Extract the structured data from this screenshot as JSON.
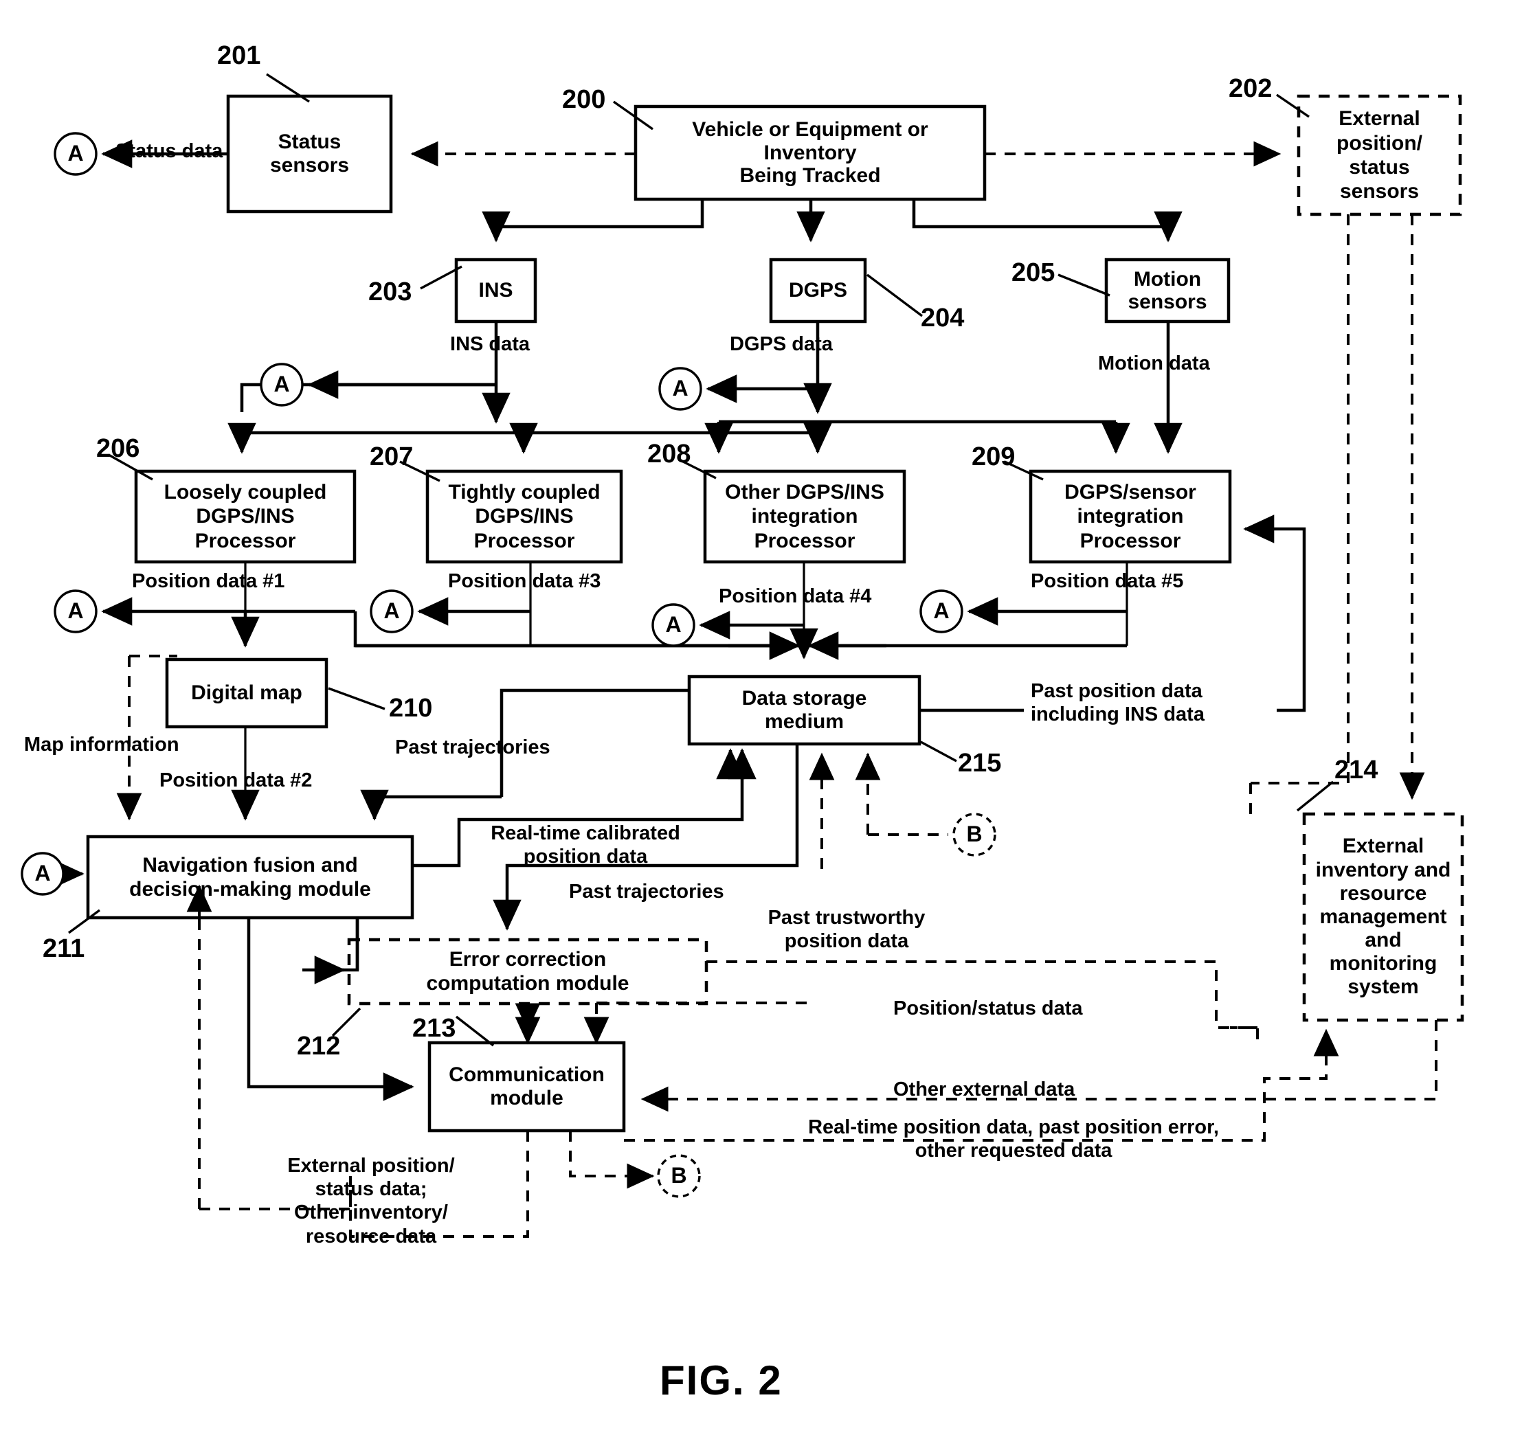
{
  "figure": {
    "caption": "FIG. 2",
    "type": "patent-block-diagram"
  },
  "blocks": [
    {
      "id": "200",
      "label": "Vehicle or Equipment or\nInventory\nBeing Tracked",
      "lines": [
        "Vehicle or Equipment or",
        "Inventory",
        "Being Tracked"
      ],
      "style": "solid"
    },
    {
      "id": "201",
      "label": "Status sensors",
      "lines": [
        "Status",
        "sensors"
      ],
      "style": "solid"
    },
    {
      "id": "202",
      "label": "External position/ status sensors",
      "lines": [
        "External",
        "position/",
        "status",
        "sensors"
      ],
      "style": "dashed"
    },
    {
      "id": "203",
      "label": "INS",
      "lines": [
        "INS"
      ],
      "style": "solid"
    },
    {
      "id": "204",
      "label": "DGPS",
      "lines": [
        "DGPS"
      ],
      "style": "solid"
    },
    {
      "id": "205",
      "label": "Motion sensors",
      "lines": [
        "Motion",
        "sensors"
      ],
      "style": "solid"
    },
    {
      "id": "206",
      "label": "Loosely coupled DGPS/INS Processor",
      "lines": [
        "Loosely coupled",
        "DGPS/INS",
        "Processor"
      ],
      "style": "solid"
    },
    {
      "id": "207",
      "label": "Tightly coupled DGPS/INS Processor",
      "lines": [
        "Tightly coupled",
        "DGPS/INS",
        "Processor"
      ],
      "style": "solid"
    },
    {
      "id": "208",
      "label": "Other DGPS/INS integration Processor",
      "lines": [
        "Other DGPS/INS",
        "integration",
        "Processor"
      ],
      "style": "solid"
    },
    {
      "id": "209",
      "label": "DGPS/sensor integration Processor",
      "lines": [
        "DGPS/sensor",
        "integration",
        "Processor"
      ],
      "style": "solid"
    },
    {
      "id": "210",
      "label": "Digital map",
      "lines": [
        "Digital map"
      ],
      "style": "solid"
    },
    {
      "id": "211",
      "label": "Navigation fusion and decision-making module",
      "lines": [
        "Navigation fusion and",
        "decision-making module"
      ],
      "style": "solid"
    },
    {
      "id": "212",
      "label": "Error correction computation module",
      "lines": [
        "Error correction",
        "computation module"
      ],
      "style": "dashed"
    },
    {
      "id": "213",
      "label": "Communication module",
      "lines": [
        "Communication",
        "module"
      ],
      "style": "solid"
    },
    {
      "id": "214",
      "label": "External inventory and resource management and monitoring system",
      "lines": [
        "External",
        "inventory and",
        "resource",
        "management",
        "and",
        "monitoring",
        "system"
      ],
      "style": "dashed"
    },
    {
      "id": "215",
      "label": "Data storage medium",
      "lines": [
        "Data storage",
        "medium"
      ],
      "style": "solid"
    }
  ],
  "connectors": [
    {
      "id": "A1",
      "symbol": "A",
      "style": "solid"
    },
    {
      "id": "A2",
      "symbol": "A",
      "style": "solid"
    },
    {
      "id": "A3",
      "symbol": "A",
      "style": "solid"
    },
    {
      "id": "A4",
      "symbol": "A",
      "style": "solid"
    },
    {
      "id": "A5",
      "symbol": "A",
      "style": "solid"
    },
    {
      "id": "A6",
      "symbol": "A",
      "style": "solid"
    },
    {
      "id": "A7",
      "symbol": "A",
      "style": "solid"
    },
    {
      "id": "B1",
      "symbol": "B",
      "style": "dashed"
    },
    {
      "id": "B2",
      "symbol": "B",
      "style": "dashed"
    }
  ],
  "edge_labels": {
    "status_data": "Status data",
    "ins_data": "INS data",
    "dgps_data": "DGPS data",
    "motion_data": "Motion data",
    "position_data_1": "Position data #1",
    "position_data_2": "Position data #2",
    "position_data_3": "Position data #3",
    "position_data_4": "Position data #4",
    "position_data_5": "Position data #5",
    "map_information": "Map information",
    "past_trajectories_a": "Past trajectories",
    "past_trajectories_b": "Past trajectories",
    "realtime_calibrated_l1": "Real-time calibrated",
    "realtime_calibrated_l2": "position data",
    "past_trustworthy_l1": "Past trustworthy",
    "past_trustworthy_l2": "position data",
    "past_position_l1": "Past position data",
    "past_position_l2": "including INS data",
    "position_status_data": "Position/status data",
    "other_external_data": "Other external data",
    "realtime_request_l1": "Real-time position data, past position error,",
    "realtime_request_l2": "other requested data",
    "external_status_l1": "External position/",
    "external_status_l2": "status data;",
    "external_status_l3": "Other inventory/",
    "external_status_l4": "resource data"
  },
  "ref_numbers": [
    "200",
    "201",
    "202",
    "203",
    "204",
    "205",
    "206",
    "207",
    "208",
    "209",
    "210",
    "211",
    "212",
    "213",
    "214",
    "215"
  ]
}
